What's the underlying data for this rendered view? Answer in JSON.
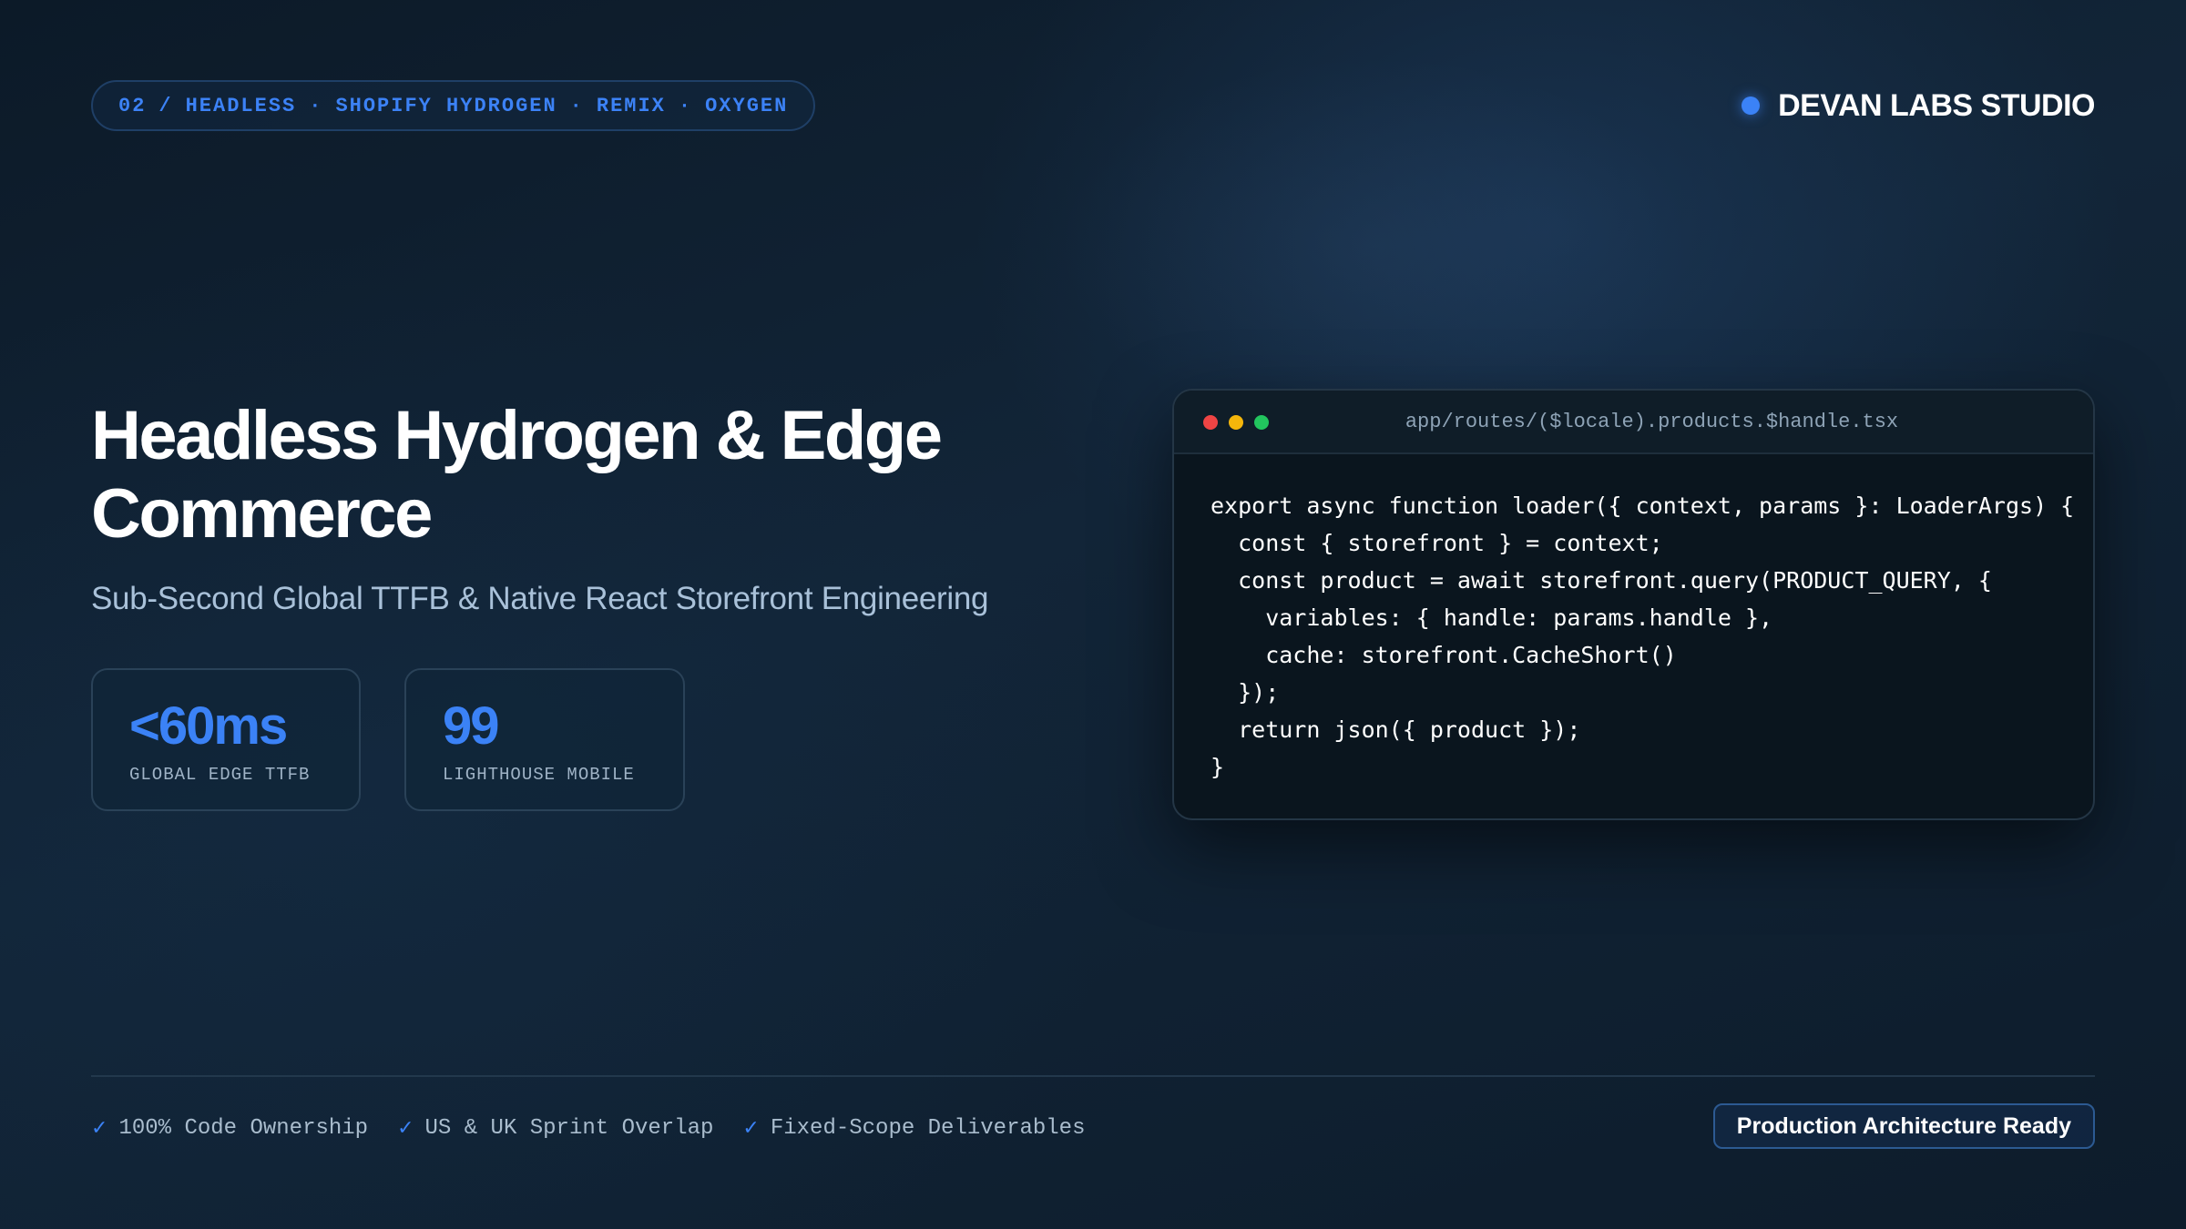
{
  "header": {
    "pill": {
      "number": "02",
      "slash": "/",
      "tags": [
        "HEADLESS",
        "SHOPIFY HYDROGEN",
        "REMIX",
        "OXYGEN"
      ],
      "separator": "·"
    },
    "brand": {
      "name": "DEVAN LABS STUDIO",
      "dot_color": "#3b82f6"
    }
  },
  "hero": {
    "title_line1": "Headless Hydrogen & Edge",
    "title_line2": "Commerce",
    "subtitle": "Sub-Second Global TTFB & Native React Storefront Engineering"
  },
  "stats": [
    {
      "value": "<60ms",
      "label": "GLOBAL EDGE TTFB"
    },
    {
      "value": "99",
      "label": "LIGHTHOUSE MOBILE"
    }
  ],
  "code_window": {
    "filename": "app/routes/($locale).products.$handle.tsx",
    "lines": [
      "export async function loader({ context, params }: LoaderArgs) {",
      "  const { storefront } = context;",
      "  const product = await storefront.query(PRODUCT_QUERY, {",
      "    variables: { handle: params.handle },",
      "    cache: storefront.CacheShort()",
      "  });",
      "  return json({ product });",
      "}"
    ]
  },
  "footer": {
    "features": [
      {
        "check": "✓",
        "label": "100% Code Ownership"
      },
      {
        "check": "✓",
        "label": "US & UK Sprint Overlap"
      },
      {
        "check": "✓",
        "label": "Fixed-Scope Deliverables"
      }
    ],
    "badge": "Production Architecture Ready"
  },
  "colors": {
    "accent": "#3b82f6",
    "background": "#0e1c2a"
  }
}
